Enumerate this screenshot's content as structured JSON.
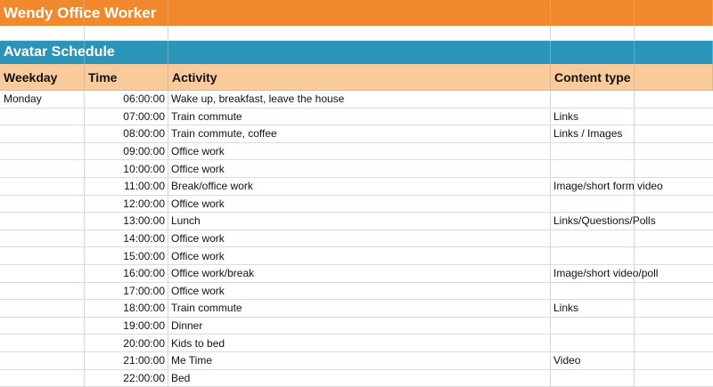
{
  "sheet": {
    "title": "Wendy Office Worker",
    "section": "Avatar Schedule",
    "headers": {
      "weekday": "Weekday",
      "time": "Time",
      "activity": "Activity",
      "content_type": "Content type"
    },
    "rows": [
      {
        "weekday": "Monday",
        "time": "06:00:00",
        "activity": "Wake up, breakfast, leave the house",
        "content_type": ""
      },
      {
        "weekday": "",
        "time": "07:00:00",
        "activity": "Train commute",
        "content_type": "Links"
      },
      {
        "weekday": "",
        "time": "08:00:00",
        "activity": "Train commute, coffee",
        "content_type": "Links / Images"
      },
      {
        "weekday": "",
        "time": "09:00:00",
        "activity": "Office work",
        "content_type": ""
      },
      {
        "weekday": "",
        "time": "10:00:00",
        "activity": "Office work",
        "content_type": ""
      },
      {
        "weekday": "",
        "time": "11:00:00",
        "activity": "Break/office work",
        "content_type": "Image/short form video"
      },
      {
        "weekday": "",
        "time": "12:00:00",
        "activity": "Office work",
        "content_type": ""
      },
      {
        "weekday": "",
        "time": "13:00:00",
        "activity": "Lunch",
        "content_type": "Links/Questions/Polls"
      },
      {
        "weekday": "",
        "time": "14:00:00",
        "activity": "Office work",
        "content_type": ""
      },
      {
        "weekday": "",
        "time": "15:00:00",
        "activity": "Office work",
        "content_type": ""
      },
      {
        "weekday": "",
        "time": "16:00:00",
        "activity": "Office work/break",
        "content_type": "Image/short video/poll"
      },
      {
        "weekday": "",
        "time": "17:00:00",
        "activity": "Office work",
        "content_type": ""
      },
      {
        "weekday": "",
        "time": "18:00:00",
        "activity": "Train commute",
        "content_type": "Links"
      },
      {
        "weekday": "",
        "time": "19:00:00",
        "activity": "Dinner",
        "content_type": ""
      },
      {
        "weekday": "",
        "time": "20:00:00",
        "activity": "Kids to bed",
        "content_type": ""
      },
      {
        "weekday": "",
        "time": "21:00:00",
        "activity": "Me Time",
        "content_type": "Video"
      },
      {
        "weekday": "",
        "time": "22:00:00",
        "activity": "Bed",
        "content_type": ""
      }
    ]
  },
  "colors": {
    "title_bg": "#f0892e",
    "section_bg": "#2a95b8",
    "header_bg": "#f9cb9c"
  }
}
